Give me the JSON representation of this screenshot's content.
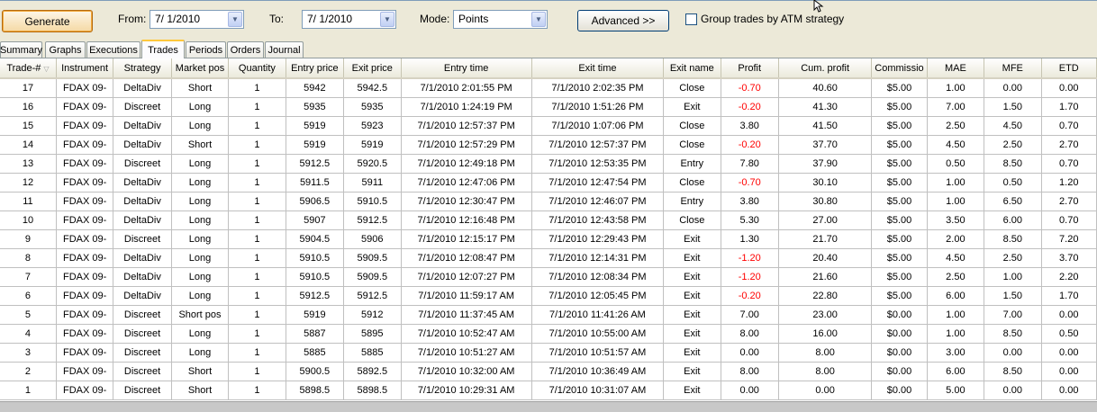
{
  "toolbar": {
    "generate_label": "Generate",
    "from_label": "From:",
    "from_value": "7/ 1/2010",
    "to_label": "To:",
    "to_value": "7/ 1/2010",
    "mode_label": "Mode:",
    "mode_value": "Points",
    "advanced_label": "Advanced >>",
    "group_label": "Group trades by ATM strategy",
    "group_checked": false
  },
  "tabs": [
    "Summary",
    "Graphs",
    "Executions",
    "Trades",
    "Periods",
    "Orders",
    "Journal"
  ],
  "active_tab": "Trades",
  "columns": [
    "Trade-#",
    "Instrument",
    "Strategy",
    "Market pos",
    "Quantity",
    "Entry price",
    "Exit price",
    "Entry time",
    "Exit time",
    "Exit name",
    "Profit",
    "Cum. profit",
    "Commissio",
    "MAE",
    "MFE",
    "ETD"
  ],
  "rows": [
    [
      "17",
      "FDAX 09-",
      "DeltaDiv",
      "Short",
      "1",
      "5942",
      "5942.5",
      "7/1/2010 2:01:55 PM",
      "7/1/2010 2:02:35 PM",
      "Close",
      "-0.70",
      "40.60",
      "$5.00",
      "1.00",
      "0.00",
      "0.00"
    ],
    [
      "16",
      "FDAX 09-",
      "Discreet",
      "Long",
      "1",
      "5935",
      "5935",
      "7/1/2010 1:24:19 PM",
      "7/1/2010 1:51:26 PM",
      "Exit",
      "-0.20",
      "41.30",
      "$5.00",
      "7.00",
      "1.50",
      "1.70"
    ],
    [
      "15",
      "FDAX 09-",
      "DeltaDiv",
      "Long",
      "1",
      "5919",
      "5923",
      "7/1/2010 12:57:37 PM",
      "7/1/2010 1:07:06 PM",
      "Close",
      "3.80",
      "41.50",
      "$5.00",
      "2.50",
      "4.50",
      "0.70"
    ],
    [
      "14",
      "FDAX 09-",
      "DeltaDiv",
      "Short",
      "1",
      "5919",
      "5919",
      "7/1/2010 12:57:29 PM",
      "7/1/2010 12:57:37 PM",
      "Close",
      "-0.20",
      "37.70",
      "$5.00",
      "4.50",
      "2.50",
      "2.70"
    ],
    [
      "13",
      "FDAX 09-",
      "Discreet",
      "Long",
      "1",
      "5912.5",
      "5920.5",
      "7/1/2010 12:49:18 PM",
      "7/1/2010 12:53:35 PM",
      "Entry",
      "7.80",
      "37.90",
      "$5.00",
      "0.50",
      "8.50",
      "0.70"
    ],
    [
      "12",
      "FDAX 09-",
      "DeltaDiv",
      "Long",
      "1",
      "5911.5",
      "5911",
      "7/1/2010 12:47:06 PM",
      "7/1/2010 12:47:54 PM",
      "Close",
      "-0.70",
      "30.10",
      "$5.00",
      "1.00",
      "0.50",
      "1.20"
    ],
    [
      "11",
      "FDAX 09-",
      "DeltaDiv",
      "Long",
      "1",
      "5906.5",
      "5910.5",
      "7/1/2010 12:30:47 PM",
      "7/1/2010 12:46:07 PM",
      "Entry",
      "3.80",
      "30.80",
      "$5.00",
      "1.00",
      "6.50",
      "2.70"
    ],
    [
      "10",
      "FDAX 09-",
      "DeltaDiv",
      "Long",
      "1",
      "5907",
      "5912.5",
      "7/1/2010 12:16:48 PM",
      "7/1/2010 12:43:58 PM",
      "Close",
      "5.30",
      "27.00",
      "$5.00",
      "3.50",
      "6.00",
      "0.70"
    ],
    [
      "9",
      "FDAX 09-",
      "Discreet",
      "Long",
      "1",
      "5904.5",
      "5906",
      "7/1/2010 12:15:17 PM",
      "7/1/2010 12:29:43 PM",
      "Exit",
      "1.30",
      "21.70",
      "$5.00",
      "2.00",
      "8.50",
      "7.20"
    ],
    [
      "8",
      "FDAX 09-",
      "DeltaDiv",
      "Long",
      "1",
      "5910.5",
      "5909.5",
      "7/1/2010 12:08:47 PM",
      "7/1/2010 12:14:31 PM",
      "Exit",
      "-1.20",
      "20.40",
      "$5.00",
      "4.50",
      "2.50",
      "3.70"
    ],
    [
      "7",
      "FDAX 09-",
      "DeltaDiv",
      "Long",
      "1",
      "5910.5",
      "5909.5",
      "7/1/2010 12:07:27 PM",
      "7/1/2010 12:08:34 PM",
      "Exit",
      "-1.20",
      "21.60",
      "$5.00",
      "2.50",
      "1.00",
      "2.20"
    ],
    [
      "6",
      "FDAX 09-",
      "DeltaDiv",
      "Long",
      "1",
      "5912.5",
      "5912.5",
      "7/1/2010 11:59:17 AM",
      "7/1/2010 12:05:45 PM",
      "Exit",
      "-0.20",
      "22.80",
      "$5.00",
      "6.00",
      "1.50",
      "1.70"
    ],
    [
      "5",
      "FDAX 09-",
      "Discreet",
      "Short pos",
      "1",
      "5919",
      "5912",
      "7/1/2010 11:37:45 AM",
      "7/1/2010 11:41:26 AM",
      "Exit",
      "7.00",
      "23.00",
      "$0.00",
      "1.00",
      "7.00",
      "0.00"
    ],
    [
      "4",
      "FDAX 09-",
      "Discreet",
      "Long",
      "1",
      "5887",
      "5895",
      "7/1/2010 10:52:47 AM",
      "7/1/2010 10:55:00 AM",
      "Exit",
      "8.00",
      "16.00",
      "$0.00",
      "1.00",
      "8.50",
      "0.50"
    ],
    [
      "3",
      "FDAX 09-",
      "Discreet",
      "Long",
      "1",
      "5885",
      "5885",
      "7/1/2010 10:51:27 AM",
      "7/1/2010 10:51:57 AM",
      "Exit",
      "0.00",
      "8.00",
      "$0.00",
      "3.00",
      "0.00",
      "0.00"
    ],
    [
      "2",
      "FDAX 09-",
      "Discreet",
      "Short",
      "1",
      "5900.5",
      "5892.5",
      "7/1/2010 10:32:00 AM",
      "7/1/2010 10:36:49 AM",
      "Exit",
      "8.00",
      "8.00",
      "$0.00",
      "6.00",
      "8.50",
      "0.00"
    ],
    [
      "1",
      "FDAX 09-",
      "Discreet",
      "Short",
      "1",
      "5898.5",
      "5898.5",
      "7/1/2010 10:29:31 AM",
      "7/1/2010 10:31:07 AM",
      "Exit",
      "0.00",
      "0.00",
      "$0.00",
      "5.00",
      "0.00",
      "0.00"
    ]
  ],
  "colors": {
    "negative": "#ff0000",
    "active_tab_accent": "#ffc83c",
    "generate_border": "#b46a10"
  },
  "icons": {
    "dropdown": "chevron-down-icon",
    "sort": "sort-arrow-icon",
    "cursor": "mouse-pointer-icon"
  }
}
